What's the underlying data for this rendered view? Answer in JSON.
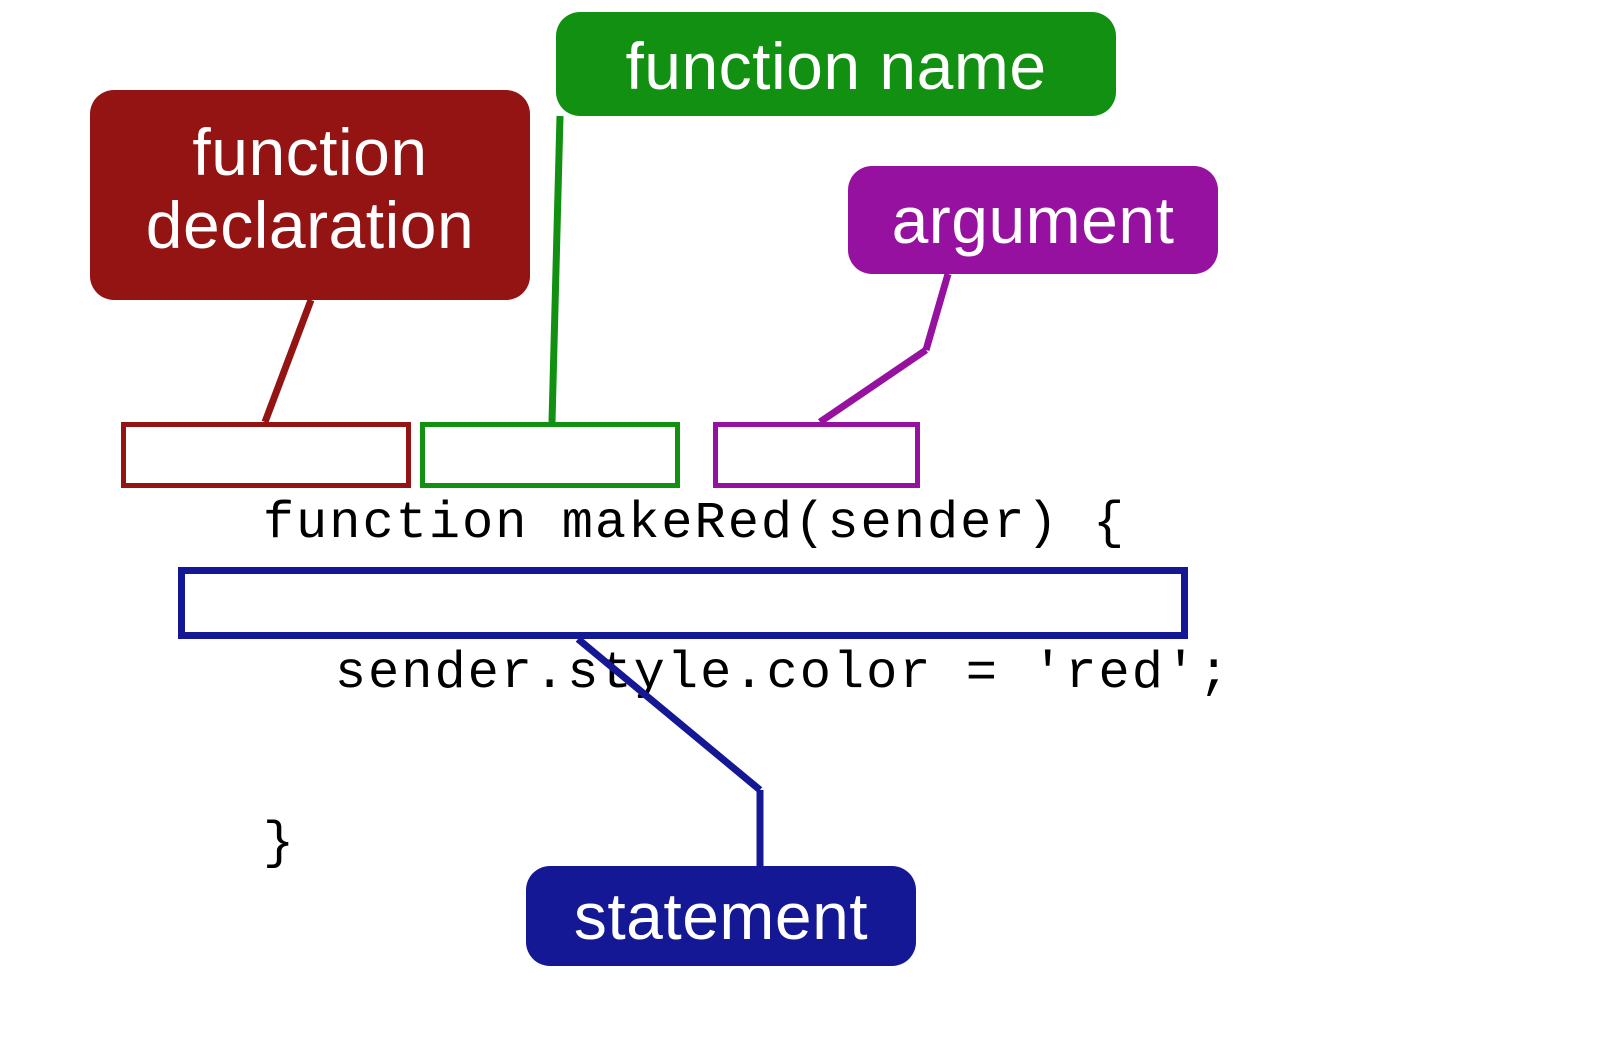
{
  "labels": {
    "function_declaration": "function\ndeclaration",
    "function_name": "function name",
    "argument": "argument",
    "statement": "statement"
  },
  "code": {
    "line1_keyword": "function",
    "line1_name": "makeRed",
    "line1_open_paren": "(",
    "line1_arg": "sender",
    "line1_close": ") {",
    "line2": "sender.style.color = 'red';",
    "line3": "}"
  },
  "colors": {
    "declaration": "#941313",
    "name": "#119011",
    "argument": "#9611a0",
    "statement": "#141895"
  }
}
